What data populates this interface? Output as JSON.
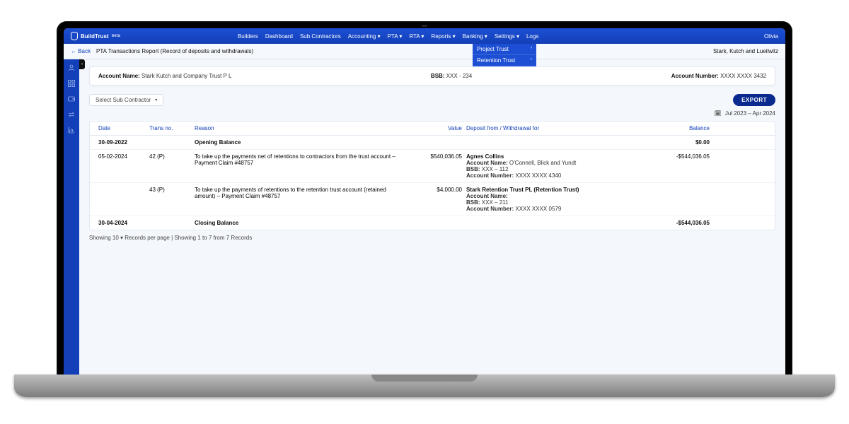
{
  "brand": {
    "name": "BuildTrust",
    "suffix": "beta"
  },
  "nav": {
    "items": [
      "Builders",
      "Dashboard",
      "Sub Contractors",
      "Accounting ▾",
      "PTA ▾",
      "RTA ▾",
      "Reports ▾",
      "Banking ▾",
      "Settings ▾",
      "Logs"
    ],
    "right_user": "Olivia"
  },
  "pta_dropdown": {
    "items": [
      "Project Trust",
      "Retention Trust"
    ]
  },
  "subheader": {
    "back": "← Back",
    "title": "PTA Transactions Report (Record of deposits and withdrawals)",
    "company": "Stark, Kutch and Lueilwitz"
  },
  "account_card": {
    "name_label": "Account Name:",
    "name_value": "Stark Kutch and Company Trust P L",
    "bsb_label": "BSB:",
    "bsb_value": "XXX - 234",
    "acct_label": "Account Number:",
    "acct_value": "XXXX XXXX 3432"
  },
  "controls": {
    "select_placeholder": "Select Sub Contractor",
    "export": "EXPORT",
    "date_range": "Jul 2023 – Apr 2024"
  },
  "table": {
    "headers": {
      "date": "Date",
      "trans": "Trans no.",
      "reason": "Reason",
      "value": "Value",
      "party": "Deposit from / Withdrawal for",
      "balance": "Balance"
    },
    "rows": [
      {
        "kind": "open",
        "date": "30-09-2022",
        "reason": "Opening Balance",
        "balance": "$0.00"
      },
      {
        "kind": "tx",
        "date": "05-02-2024",
        "trans": "42 (P)",
        "reason": "To take up the payments net of retentions to contractors from the trust account – Payment Claim #48757",
        "value": "$540,036.05",
        "party": {
          "name": "Agnes Collins",
          "acct_name_label": "Account Name:",
          "acct_name": "O'Connell, Blick and Yundt",
          "bsb_label": "BSB:",
          "bsb": "XXX – 112",
          "num_label": "Account Number:",
          "num": "XXXX XXXX 4340"
        },
        "balance": "-$544,036.05"
      },
      {
        "kind": "tx",
        "date": "",
        "trans": "43 (P)",
        "reason": "To take up the payments of retentions to the retention trust account (retained amount) – Payment Claim #48757",
        "value": "$4,000.00",
        "party": {
          "name": "Stark Retention Trust PL (Retention Trust)",
          "acct_name_label": "Account Name:",
          "acct_name": "",
          "bsb_label": "BSB:",
          "bsb": "XXX – 211",
          "num_label": "Account Number:",
          "num": "XXXX XXXX 0579"
        },
        "balance": ""
      },
      {
        "kind": "close",
        "date": "30-04-2024",
        "reason": "Closing Balance",
        "balance": "-$544,036.05"
      }
    ]
  },
  "pager": {
    "text": "Showing 10 ▾ Records per page | Showing 1 to 7 from 7 Records"
  }
}
